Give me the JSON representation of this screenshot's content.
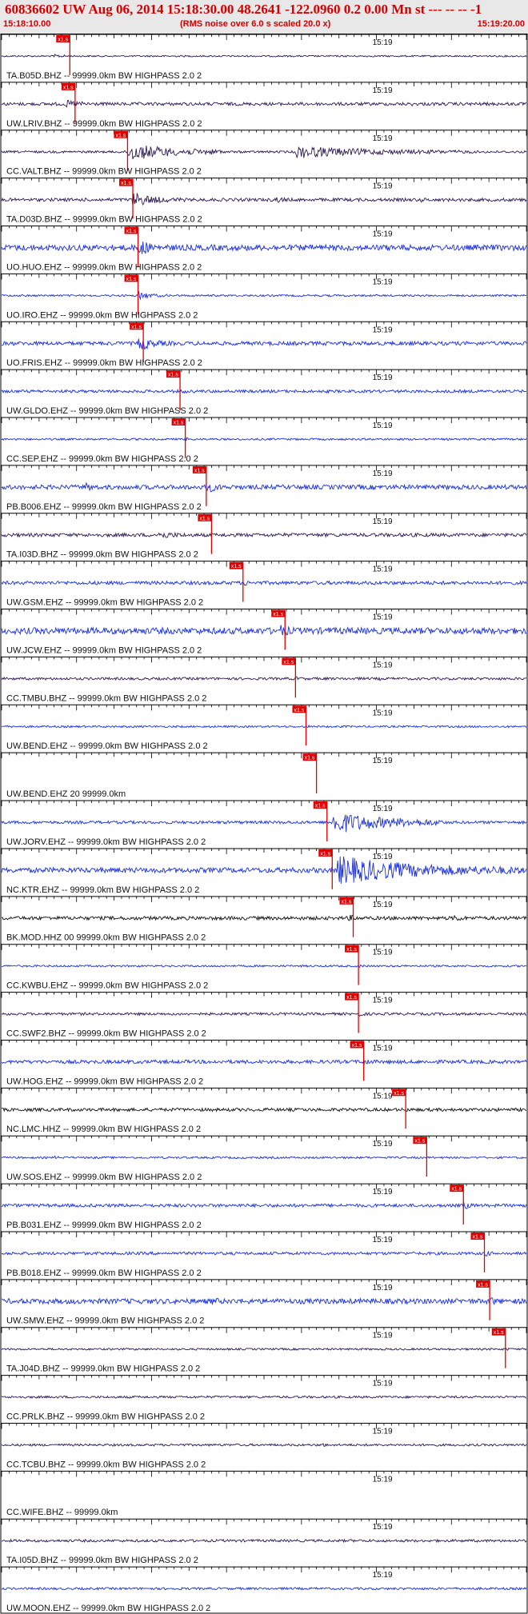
{
  "header": {
    "title": "60836602 UW Aug 06, 2014 15:18:30.00   48.2641 -122.0960  0.2 0.00 Mn st --- -- --  -1",
    "start_time": "15:18:10.00",
    "note": "(RMS noise over 6.0 s scaled 20.0 x)",
    "end_time": "15:19:20.00"
  },
  "colors": {
    "black": "#111111",
    "dark": "#2b1a55",
    "blue": "#1a2fe0",
    "pick_line": "#e00000",
    "pick_box": "#e00000"
  },
  "chart_data": {
    "type": "seismogram",
    "title": "60836602 UW Aug 06, 2014 15:18:30.00",
    "x_range": [
      "15:18:10.00",
      "15:19:20.00"
    ],
    "time_tick_label": "15:19",
    "pick_label": "x1.s",
    "channels": [
      {
        "label": "TA.B05D.BHZ -- 99999.0km BW  HIGHPASS  2.0  2",
        "color": "dark",
        "pick": 0.13,
        "amp": 0.25,
        "burst": [
          [
            0.1,
            0.18,
            2.5
          ]
        ]
      },
      {
        "label": "UW.LRIV.BHZ -- 99999.0km BW  HIGHPASS  2.0  2",
        "color": "dark",
        "pick": 0.14,
        "amp": 0.5,
        "burst": [
          [
            0.12,
            0.26,
            2.5
          ],
          [
            0.78,
            0.84,
            1.4
          ],
          [
            0.92,
            0.98,
            1.3
          ]
        ]
      },
      {
        "label": "CC.VALT.BHZ -- 99999.0km BW  HIGHPASS  2.0  2",
        "color": "dark",
        "pick": 0.24,
        "amp": 0.35,
        "burst": [
          [
            0.24,
            0.42,
            9
          ],
          [
            0.56,
            0.9,
            6
          ]
        ]
      },
      {
        "label": "TA.D03D.BHZ -- 99999.0km BW  HIGHPASS  2.0  2",
        "color": "dark",
        "pick": 0.25,
        "amp": 0.5,
        "burst": [
          [
            0.25,
            0.35,
            5
          ],
          [
            0.52,
            0.6,
            2.2
          ],
          [
            0.8,
            0.86,
            1.6
          ]
        ]
      },
      {
        "label": "UO.HUO.EHZ -- 99999.0km BW  HIGHPASS  2.0  2",
        "color": "blue",
        "pick": 0.26,
        "amp": 0.9,
        "burst": [
          [
            0.26,
            0.32,
            3.5
          ]
        ]
      },
      {
        "label": "UO.IRO.EHZ -- 99999.0km BW  HIGHPASS  2.0  2",
        "color": "blue",
        "pick": 0.26,
        "amp": 0.3,
        "burst": [
          [
            0.26,
            0.32,
            5
          ]
        ]
      },
      {
        "label": "UO.FRIS.EHZ -- 99999.0km BW  HIGHPASS  2.0  2",
        "color": "blue",
        "pick": 0.27,
        "amp": 0.6,
        "burst": [
          [
            0.26,
            0.33,
            4.5
          ]
        ]
      },
      {
        "label": "UW.GLDO.EHZ -- 99999.0km BW  HIGHPASS  2.0  2",
        "color": "blue",
        "pick": 0.34,
        "amp": 0.45,
        "burst": [
          [
            0.34,
            0.38,
            2
          ]
        ]
      },
      {
        "label": "CC.SEP.EHZ -- 99999.0km BW  HIGHPASS  2.0  2",
        "color": "blue",
        "pick": 0.35,
        "amp": 0.3,
        "burst": [
          [
            0.35,
            0.4,
            2.2
          ]
        ]
      },
      {
        "label": "PB.B006.EHZ -- 99999.0km BW  HIGHPASS  2.0  2",
        "color": "blue",
        "pick": 0.39,
        "amp": 0.7,
        "burst": [
          [
            0.16,
            0.22,
            2.2
          ],
          [
            0.39,
            0.45,
            3
          ]
        ]
      },
      {
        "label": "TA.I03D.BHZ -- 99999.0km BW  HIGHPASS  2.0  2",
        "color": "dark",
        "pick": 0.4,
        "amp": 0.55,
        "burst": [
          [
            0.3,
            0.45,
            2.2
          ]
        ]
      },
      {
        "label": "UW.GSM.EHZ -- 99999.0km BW  HIGHPASS  2.0  2",
        "color": "blue",
        "pick": 0.46,
        "amp": 0.55,
        "burst": [
          [
            0.46,
            0.5,
            2.2
          ]
        ]
      },
      {
        "label": "UW.JCW.EHZ -- 99999.0km BW  HIGHPASS  2.0  2",
        "color": "blue",
        "pick": 0.54,
        "amp": 1.0,
        "burst": [
          [
            0.53,
            0.6,
            2.2
          ]
        ]
      },
      {
        "label": "CC.TMBU.BHZ -- 99999.0km BW  HIGHPASS  2.0  2",
        "color": "dark",
        "pick": 0.56,
        "amp": 0.4,
        "burst": [
          [
            0.56,
            0.62,
            1.8
          ],
          [
            0.72,
            0.76,
            1.5
          ]
        ]
      },
      {
        "label": "UW.BEND.EHZ -- 99999.0km BW  HIGHPASS  2.0  2",
        "color": "blue",
        "pick": 0.58,
        "amp": 0.3,
        "burst": [
          [
            0.58,
            0.61,
            2
          ]
        ]
      },
      {
        "label": "UW.BEND.EHZ 20 99999.0km",
        "color": "none",
        "pick": 0.6,
        "amp": 0,
        "burst": []
      },
      {
        "label": "UW.JORV.EHZ -- 99999.0km BW  HIGHPASS  2.0  2",
        "color": "blue",
        "pick": 0.62,
        "amp": 0.45,
        "burst": [
          [
            0.63,
            0.84,
            9
          ]
        ]
      },
      {
        "label": "NC.KTR.EHZ -- 99999.0km BW  HIGHPASS  2.0  2",
        "color": "blue",
        "pick": 0.63,
        "amp": 0.8,
        "burst": [
          [
            0.64,
            0.99,
            6
          ]
        ]
      },
      {
        "label": "BK.MOD.HHZ 00 99999.0km BW  HIGHPASS  2.0  2",
        "color": "black",
        "pick": 0.67,
        "amp": 0.55,
        "burst": [
          [
            0.66,
            0.72,
            2.2
          ],
          [
            0.86,
            0.92,
            2.5
          ]
        ]
      },
      {
        "label": "CC.KWBU.EHZ -- 99999.0km BW  HIGHPASS  2.0  2",
        "color": "blue",
        "pick": 0.68,
        "amp": 0.3,
        "burst": [
          [
            0.68,
            0.72,
            2
          ]
        ]
      },
      {
        "label": "CC.SWF2.BHZ -- 99999.0km BW  HIGHPASS  2.0  2",
        "color": "dark",
        "pick": 0.68,
        "amp": 0.4,
        "burst": [
          [
            0.68,
            0.75,
            2
          ]
        ]
      },
      {
        "label": "UW.HOG.EHZ -- 99999.0km BW  HIGHPASS  2.0  2",
        "color": "blue",
        "pick": 0.69,
        "amp": 0.55,
        "burst": [
          [
            0.69,
            0.72,
            3
          ]
        ]
      },
      {
        "label": "NC.LMC.HHZ -- 99999.0km BW  HIGHPASS  2.0  2",
        "color": "black",
        "pick": 0.77,
        "amp": 0.5,
        "burst": [
          [
            0.77,
            0.8,
            1.6
          ]
        ]
      },
      {
        "label": "UW.SOS.EHZ -- 99999.0km BW  HIGHPASS  2.0  2",
        "color": "blue",
        "pick": 0.81,
        "amp": 0.3,
        "burst": [
          [
            0.1,
            0.16,
            1.8
          ]
        ]
      },
      {
        "label": "PB.B031.EHZ -- 99999.0km BW  HIGHPASS  2.0  2",
        "color": "blue",
        "pick": 0.88,
        "amp": 0.5,
        "burst": [
          [
            0.88,
            0.92,
            3
          ]
        ]
      },
      {
        "label": "PB.B018.EHZ -- 99999.0km BW  HIGHPASS  2.0  2",
        "color": "blue",
        "pick": 0.92,
        "amp": 0.45,
        "burst": [
          [
            0.92,
            0.96,
            2.5
          ]
        ]
      },
      {
        "label": "UW.SMW.EHZ -- 99999.0km BW  HIGHPASS  2.0  2",
        "color": "blue",
        "pick": 0.93,
        "amp": 0.8,
        "burst": [
          [
            0.4,
            0.5,
            1.5
          ],
          [
            0.93,
            0.98,
            2
          ]
        ]
      },
      {
        "label": "TA.J04D.BHZ -- 99999.0km BW  HIGHPASS  2.0  2",
        "color": "dark",
        "pick": 0.96,
        "amp": 0.3,
        "burst": [
          [
            0.96,
            0.99,
            2
          ]
        ]
      },
      {
        "label": "CC.PRLK.BHZ -- 99999.0km BW  HIGHPASS  2.0  2",
        "color": "dark",
        "pick": null,
        "amp": 0.35,
        "burst": []
      },
      {
        "label": "CC.TCBU.BHZ -- 99999.0km BW  HIGHPASS  2.0  2",
        "color": "dark",
        "pick": null,
        "amp": 0.35,
        "burst": [
          [
            0.61,
            0.64,
            2.2
          ]
        ]
      },
      {
        "label": "CC.WIFE.BHZ -- 99999.0km",
        "color": "none",
        "pick": null,
        "amp": 0,
        "burst": []
      },
      {
        "label": "TA.I05D.BHZ -- 99999.0km BW  HIGHPASS  2.0  2",
        "color": "dark",
        "pick": null,
        "amp": 0.4,
        "burst": []
      },
      {
        "label": "UW.MOON.EHZ -- 99999.0km BW  HIGHPASS  2.0  2",
        "color": "blue",
        "pick": null,
        "amp": 0.35,
        "burst": []
      }
    ]
  }
}
